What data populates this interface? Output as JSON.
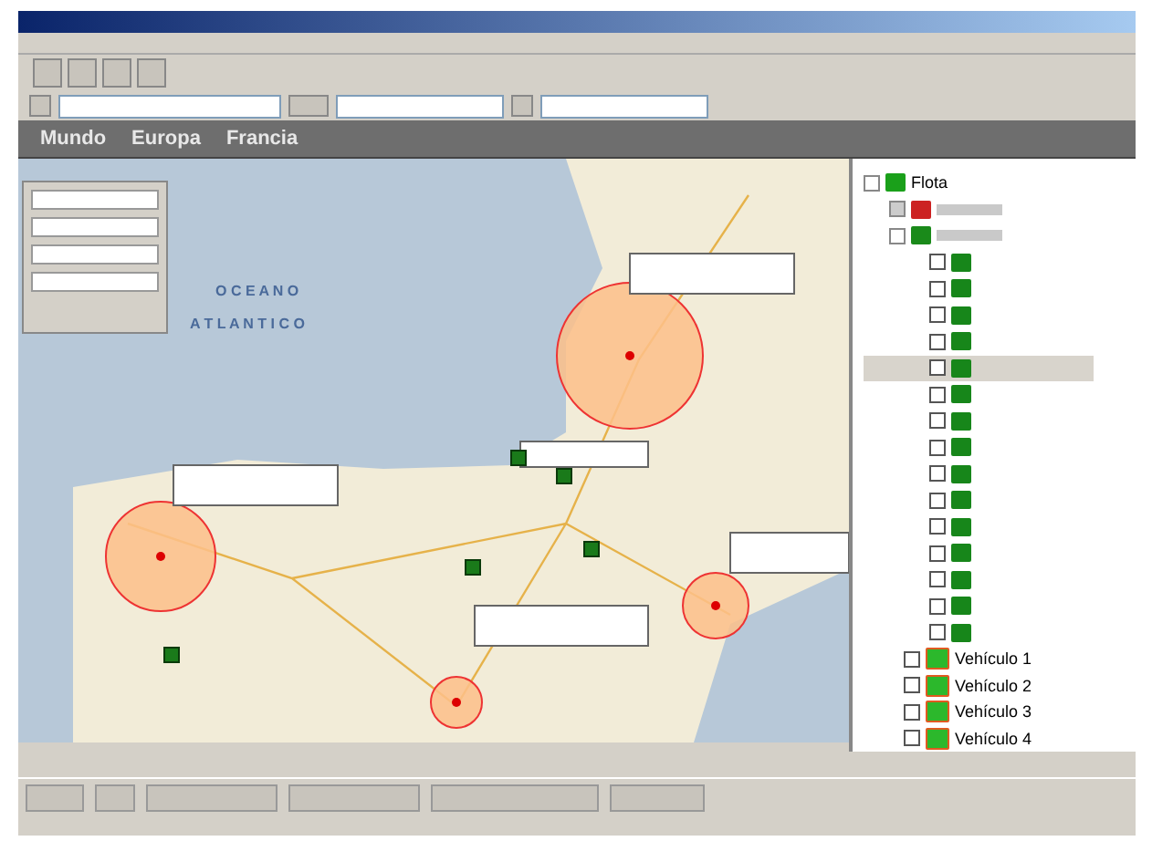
{
  "header_tabs": [
    {
      "label": "Mundo"
    },
    {
      "label": "Europa"
    },
    {
      "label": "Francia"
    }
  ],
  "map": {
    "sea_labels": [
      "O C E A N O",
      "A T L A N T I C O"
    ],
    "zones": [
      {
        "kind": "large"
      },
      {
        "kind": "medium"
      },
      {
        "kind": "small"
      },
      {
        "kind": "tiny"
      }
    ]
  },
  "tree": {
    "label": "Flota",
    "expanded": true,
    "children": [
      {
        "kind": "group",
        "color": "#cc2222",
        "expanded": false
      },
      {
        "kind": "group",
        "color": "#1a8a1a",
        "expanded": true,
        "children": [
          {
            "kind": "vehicle",
            "selected": false
          },
          {
            "kind": "vehicle",
            "selected": false
          },
          {
            "kind": "vehicle",
            "selected": false
          },
          {
            "kind": "vehicle",
            "selected": false
          },
          {
            "kind": "vehicle",
            "selected": true
          },
          {
            "kind": "vehicle",
            "selected": false
          },
          {
            "kind": "vehicle",
            "selected": false
          },
          {
            "kind": "vehicle",
            "selected": false
          },
          {
            "kind": "vehicle",
            "selected": false
          },
          {
            "kind": "vehicle",
            "selected": false
          },
          {
            "kind": "vehicle",
            "selected": false
          },
          {
            "kind": "vehicle",
            "selected": false
          },
          {
            "kind": "vehicle",
            "selected": false
          },
          {
            "kind": "vehicle",
            "selected": false
          },
          {
            "kind": "vehicle",
            "selected": false
          }
        ]
      },
      {
        "kind": "named",
        "label": "Vehículo 1",
        "checked": false
      },
      {
        "kind": "named",
        "label": "Vehículo 2",
        "checked": false
      },
      {
        "kind": "named",
        "label": "Vehículo 3",
        "checked": false
      },
      {
        "kind": "named",
        "label": "Vehículo 4",
        "checked": false
      }
    ]
  }
}
